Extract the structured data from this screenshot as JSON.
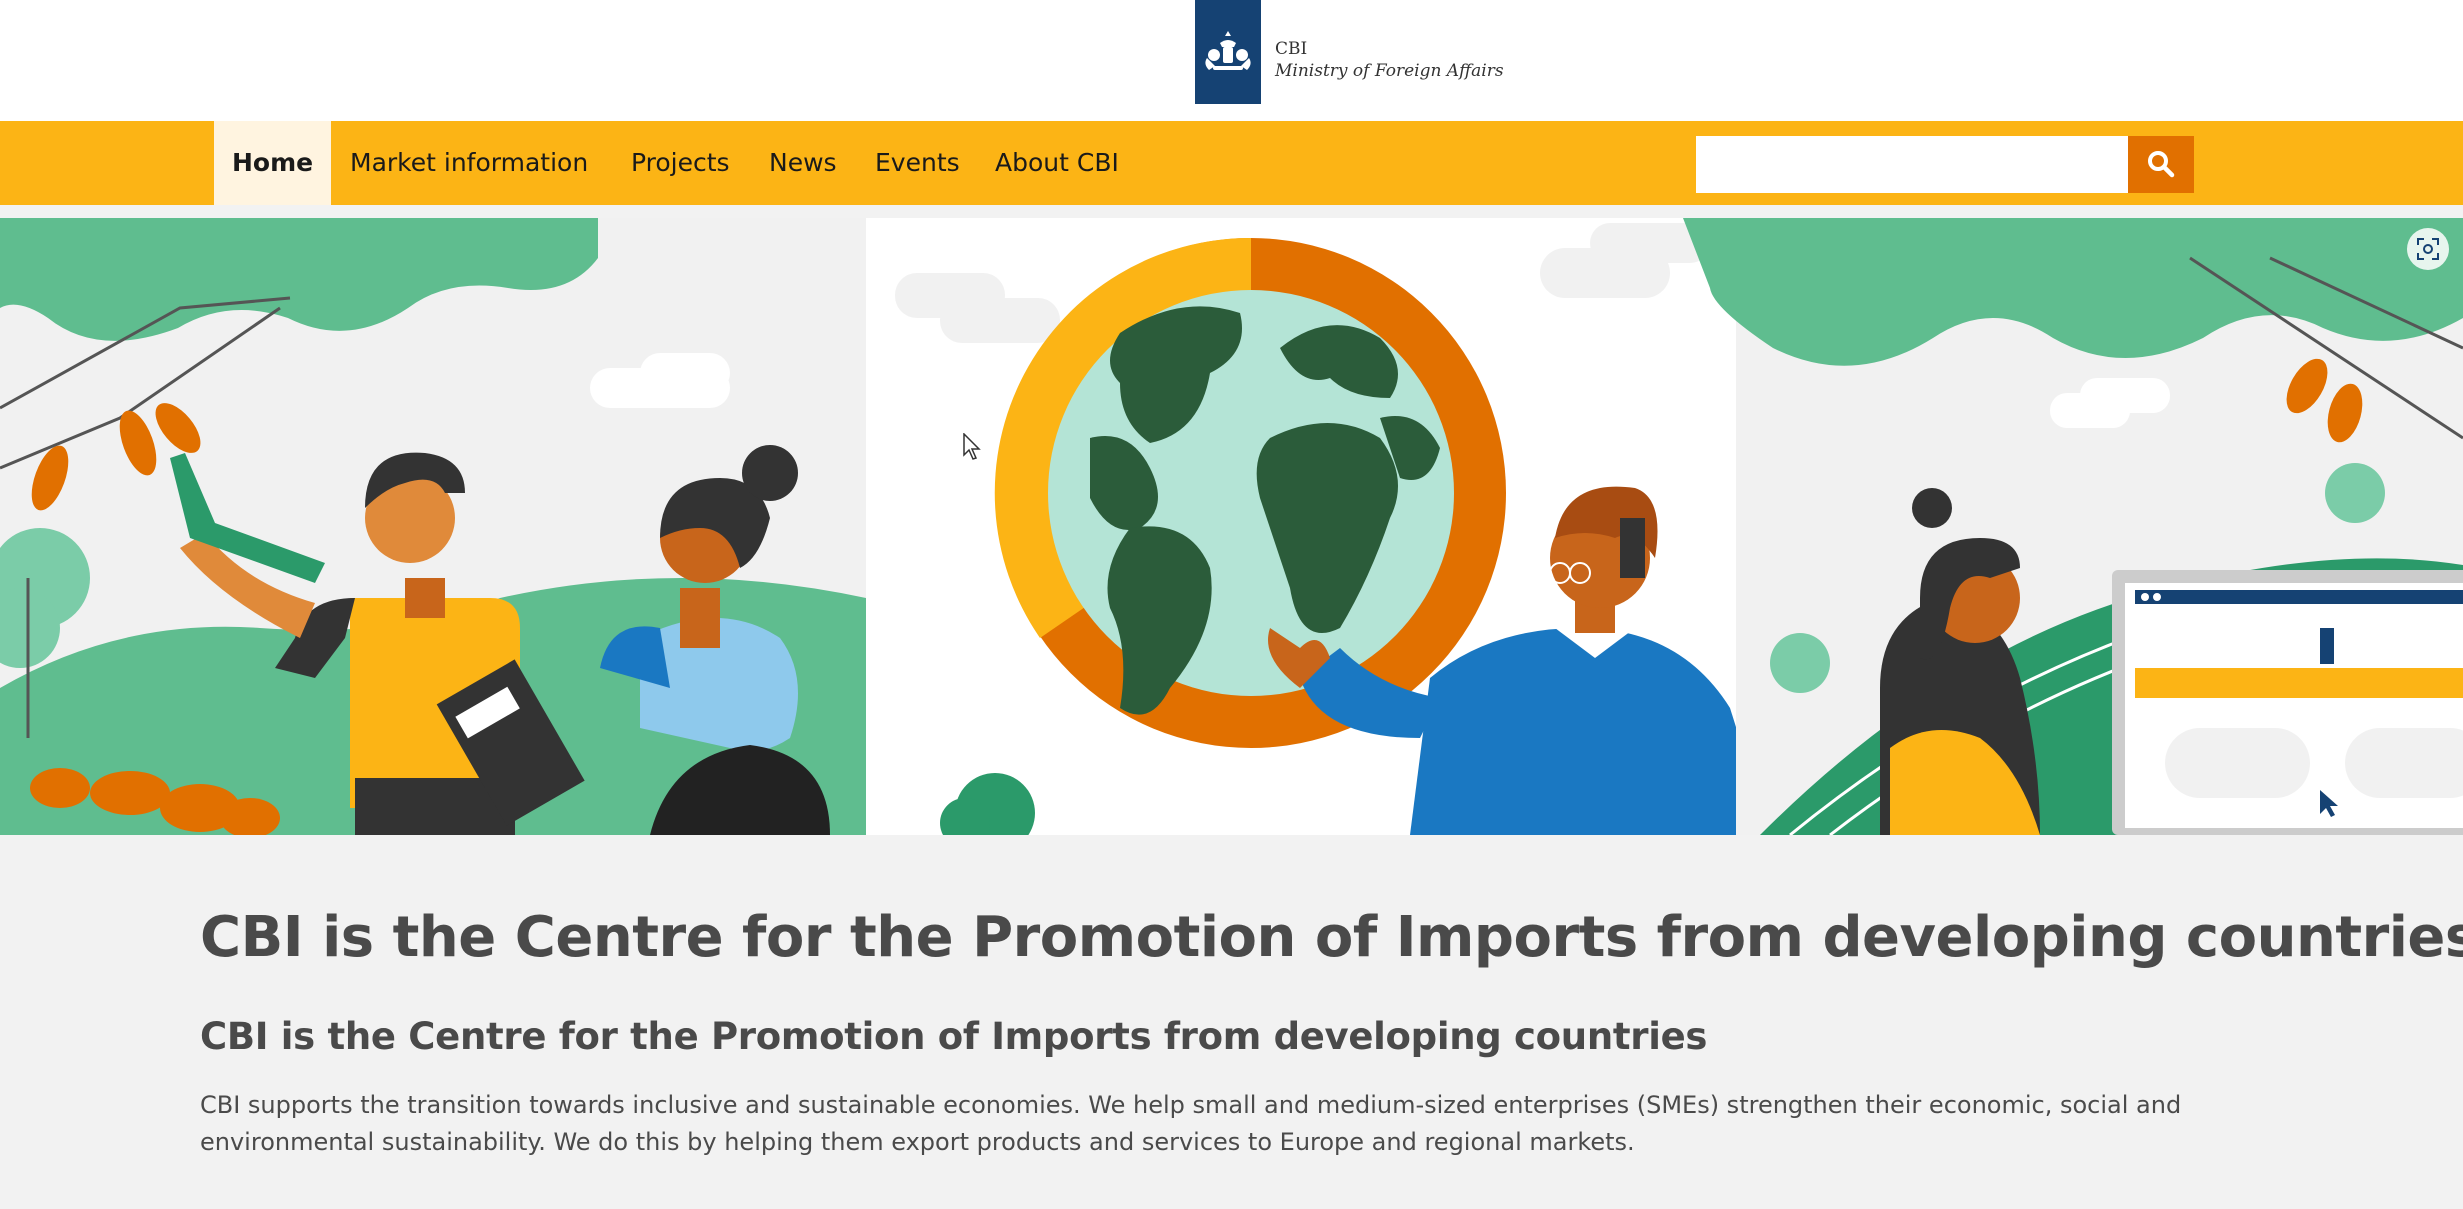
{
  "header": {
    "logo_line1": "CBI",
    "logo_line2": "Ministry of Foreign Affairs",
    "brand_color": "#154273"
  },
  "nav": {
    "items": [
      {
        "label": "Home",
        "active": true
      },
      {
        "label": "Market information"
      },
      {
        "label": "Projects"
      },
      {
        "label": "News"
      },
      {
        "label": "Events"
      },
      {
        "label": "About CBI"
      }
    ],
    "bar_color": "#fcb415",
    "search_placeholder": "",
    "search_icon": "search-icon",
    "search_button_color": "#e17000"
  },
  "hero": {
    "expand_icon": "expand-icon"
  },
  "content": {
    "title": "CBI is the Centre for the Promotion of Imports from developing countries",
    "subtitle": "CBI is the Centre for the Promotion of Imports from developing countries",
    "intro": "CBI supports the transition towards inclusive and sustainable economies. We help small and medium-sized enterprises (SMEs) strengthen their economic, social and environmental sustainability. We do this by helping them export products and services to Europe and regional markets."
  }
}
